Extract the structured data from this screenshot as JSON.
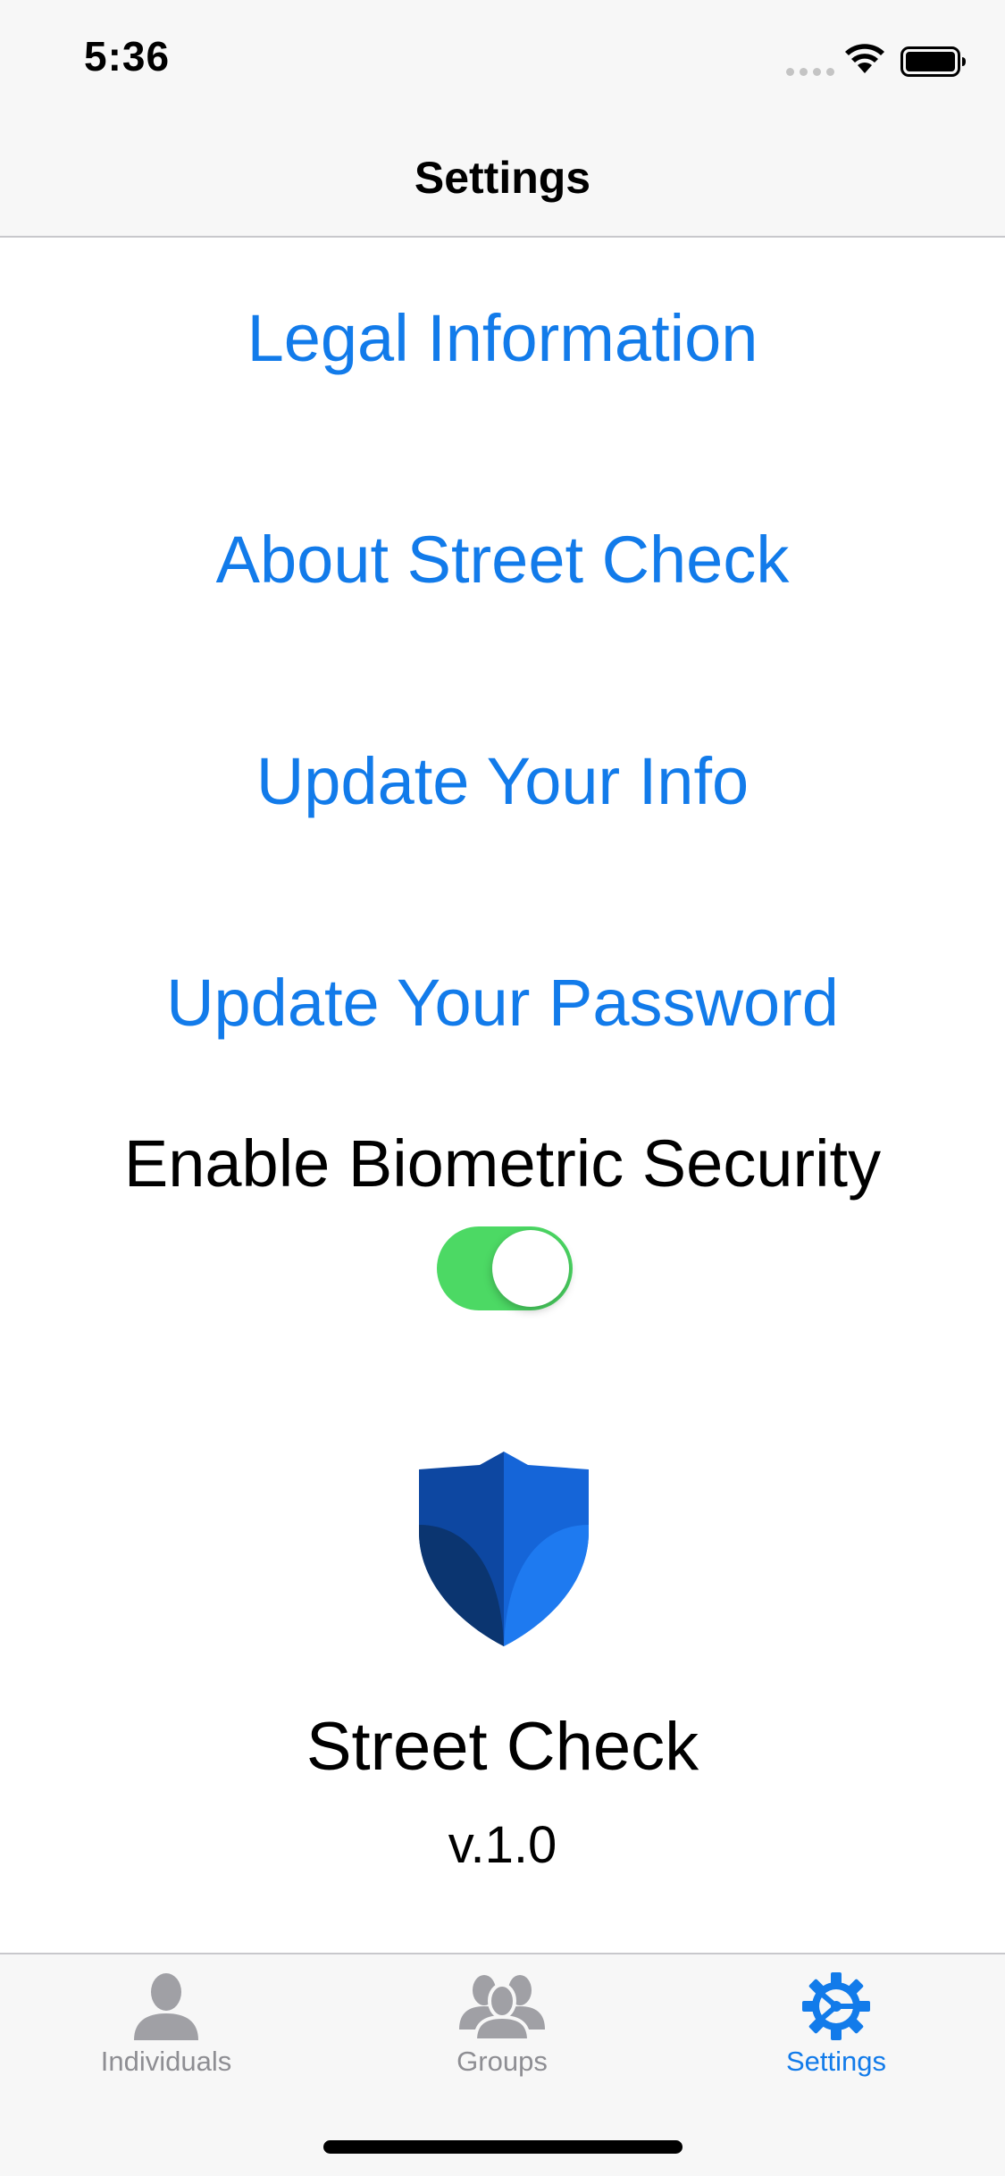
{
  "status_bar": {
    "time": "5:36"
  },
  "nav": {
    "title": "Settings"
  },
  "menu": {
    "legal": "Legal Information",
    "about": "About Street Check",
    "update_info": "Update Your Info",
    "update_password": "Update Your Password"
  },
  "biometric": {
    "label": "Enable Biometric Security",
    "enabled": true
  },
  "app": {
    "name": "Street Check",
    "version": "v.1.0",
    "logo_icon": "shield-icon"
  },
  "tabs": [
    {
      "label": "Individuals",
      "icon": "person-icon",
      "active": false
    },
    {
      "label": "Groups",
      "icon": "group-icon",
      "active": false
    },
    {
      "label": "Settings",
      "icon": "gear-icon",
      "active": true
    }
  ],
  "colors": {
    "accent": "#127bea",
    "toggle_on": "#4cd964",
    "inactive_tab": "#8e8e93"
  }
}
